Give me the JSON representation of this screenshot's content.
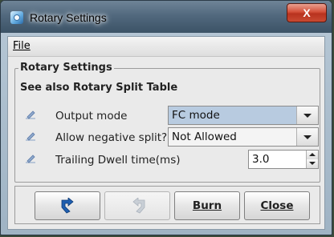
{
  "window": {
    "title": "Rotary Settings",
    "close_label": "X"
  },
  "menu": {
    "file_label": "File"
  },
  "panel": {
    "title": "Rotary Settings",
    "see_also": "See also Rotary Split Table",
    "rows": [
      {
        "label": "Output mode",
        "value": "FC mode",
        "control": "select",
        "highlighted": true
      },
      {
        "label": "Allow negative split?",
        "value": "Not Allowed",
        "control": "select",
        "highlighted": false
      },
      {
        "label": "Trailing Dwell time(ms)",
        "value": "3.0",
        "control": "spinner"
      }
    ]
  },
  "buttons": {
    "undo": {
      "icon": "undo-arrow-icon",
      "enabled": true
    },
    "redo": {
      "icon": "redo-arrow-icon",
      "enabled": false
    },
    "burn_label": "Burn",
    "close_label": "Close"
  },
  "colors": {
    "highlight": "#b8cbe0",
    "row_icon": "#6c8fc4"
  }
}
